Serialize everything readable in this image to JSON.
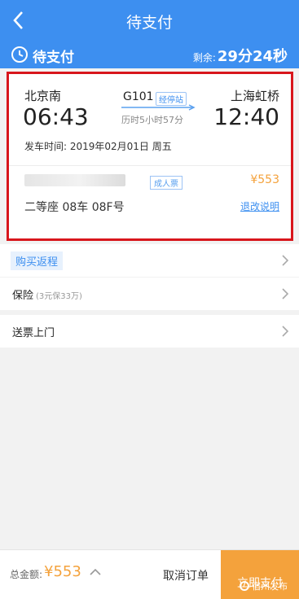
{
  "header": {
    "title": "待支付"
  },
  "status": {
    "label": "待支付",
    "remain_label": "剩余:",
    "remain_time": "29分24秒"
  },
  "ticket": {
    "from_station": "北京南",
    "to_station": "上海虹桥",
    "depart_time": "06:43",
    "arrive_time": "12:40",
    "train_no": "G101",
    "via_label": "经停站",
    "duration": "历时5小时57分",
    "depart_date": "发车时间:  2019年02月01日 周五",
    "passenger_type": "成人票",
    "price": "¥553",
    "seat": "二等座 08车 08F号",
    "rules_link": "退改说明"
  },
  "options": {
    "return_trip": "购买返程",
    "insurance": "保险",
    "insurance_detail": "(3元保33万)",
    "delivery": "送票上门"
  },
  "footer": {
    "total_label": "总金额:",
    "total_value": "¥553",
    "cancel_label": "取消订单",
    "pay_label": "立即支付"
  },
  "watermark": {
    "text": "宿州发布"
  },
  "colors": {
    "primary": "#3d8ff0",
    "accent": "#f4a23c",
    "highlight": "#d8161c"
  }
}
